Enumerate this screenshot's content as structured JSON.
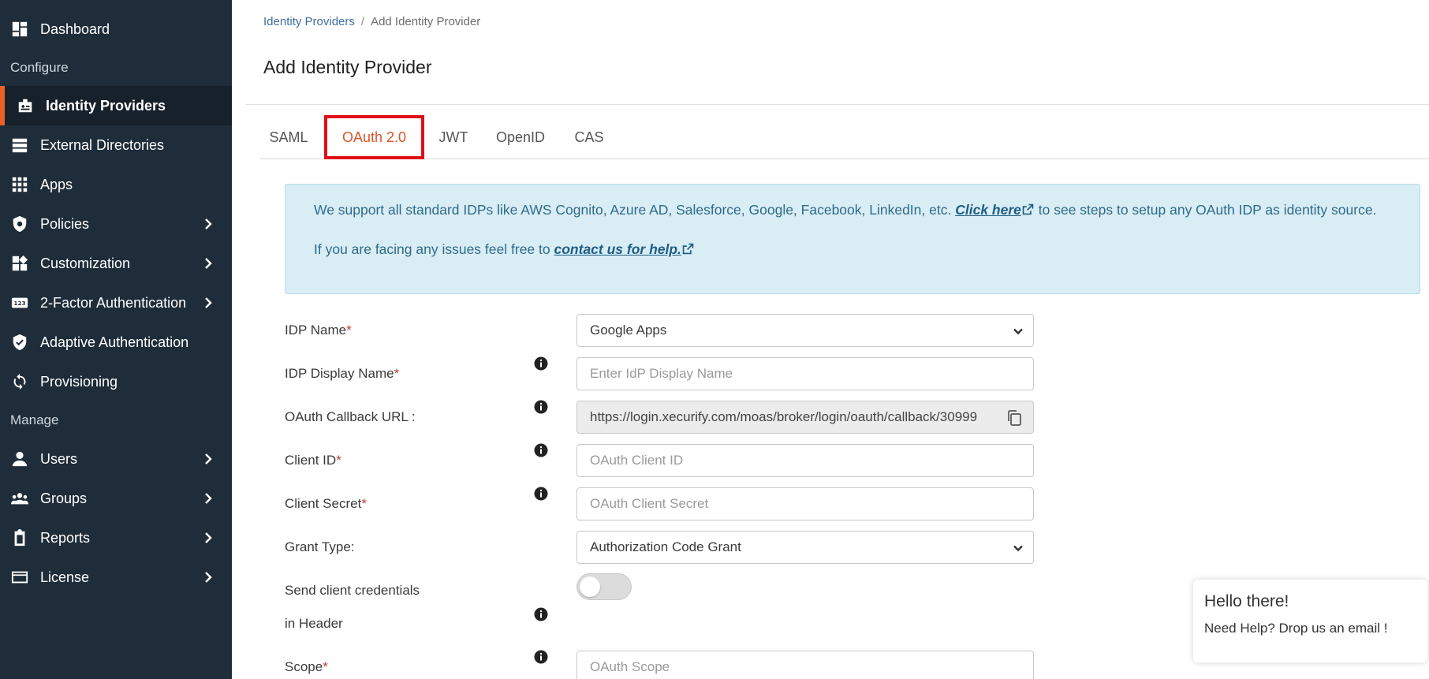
{
  "sidebar": {
    "items": [
      {
        "label": "Dashboard",
        "icon": "dashboard-icon"
      },
      {
        "label": "Identity Providers",
        "icon": "id-badge-icon",
        "active": true
      },
      {
        "label": "External Directories",
        "icon": "database-icon"
      },
      {
        "label": "Apps",
        "icon": "grid-icon"
      },
      {
        "label": "Policies",
        "icon": "shield-gear-icon"
      },
      {
        "label": "Customization",
        "icon": "widgets-icon"
      },
      {
        "label": "2-Factor Authentication",
        "icon": "123-icon"
      },
      {
        "label": "Adaptive Authentication",
        "icon": "shield-check-icon"
      },
      {
        "label": "Provisioning",
        "icon": "sync-icon"
      },
      {
        "label": "Users",
        "icon": "user-icon"
      },
      {
        "label": "Groups",
        "icon": "group-icon"
      },
      {
        "label": "Reports",
        "icon": "clipboard-icon"
      },
      {
        "label": "License",
        "icon": "card-icon"
      }
    ],
    "sections": {
      "configure": "Configure",
      "manage": "Manage"
    }
  },
  "breadcrumb": {
    "parent": "Identity Providers",
    "separator": "/",
    "current": "Add Identity Provider"
  },
  "page": {
    "title": "Add Identity Provider"
  },
  "tabs": [
    {
      "label": "SAML"
    },
    {
      "label": "OAuth 2.0",
      "active": true
    },
    {
      "label": "JWT"
    },
    {
      "label": "OpenID"
    },
    {
      "label": "CAS"
    }
  ],
  "info": {
    "line1_pre": "We support all standard IDPs like AWS Cognito, Azure AD, Salesforce, Google, Facebook, LinkedIn, etc.",
    "line1_link": "Click here",
    "line1_post": "to see steps to setup any OAuth IDP as identity source.",
    "line2_pre": "If you are facing any issues feel free to",
    "line2_link": "contact us for help."
  },
  "form": {
    "idp_name": {
      "label": "IDP Name",
      "value": "Google Apps"
    },
    "idp_display_name": {
      "label": "IDP Display Name",
      "placeholder": "Enter IdP Display Name"
    },
    "callback_url": {
      "label": "OAuth Callback URL :",
      "value": "https://login.xecurify.com/moas/broker/login/oauth/callback/30999"
    },
    "client_id": {
      "label": "Client ID",
      "placeholder": "OAuth Client ID"
    },
    "client_secret": {
      "label": "Client Secret",
      "placeholder": "OAuth Client Secret"
    },
    "grant_type": {
      "label": "Grant Type:",
      "value": "Authorization Code Grant"
    },
    "send_creds": {
      "label_line1": "Send client credentials",
      "label_line2": "in Header"
    },
    "scope": {
      "label": "Scope",
      "placeholder": "OAuth Scope"
    },
    "required_mark": "*"
  },
  "help_widget": {
    "title": "Hello there!",
    "subtitle": "Need Help? Drop us an email !"
  },
  "colors": {
    "sidebar_bg": "#1f2d3a",
    "accent": "#e8622a",
    "tab_highlight": "#e0101a",
    "info_bg": "#d9edf5"
  }
}
